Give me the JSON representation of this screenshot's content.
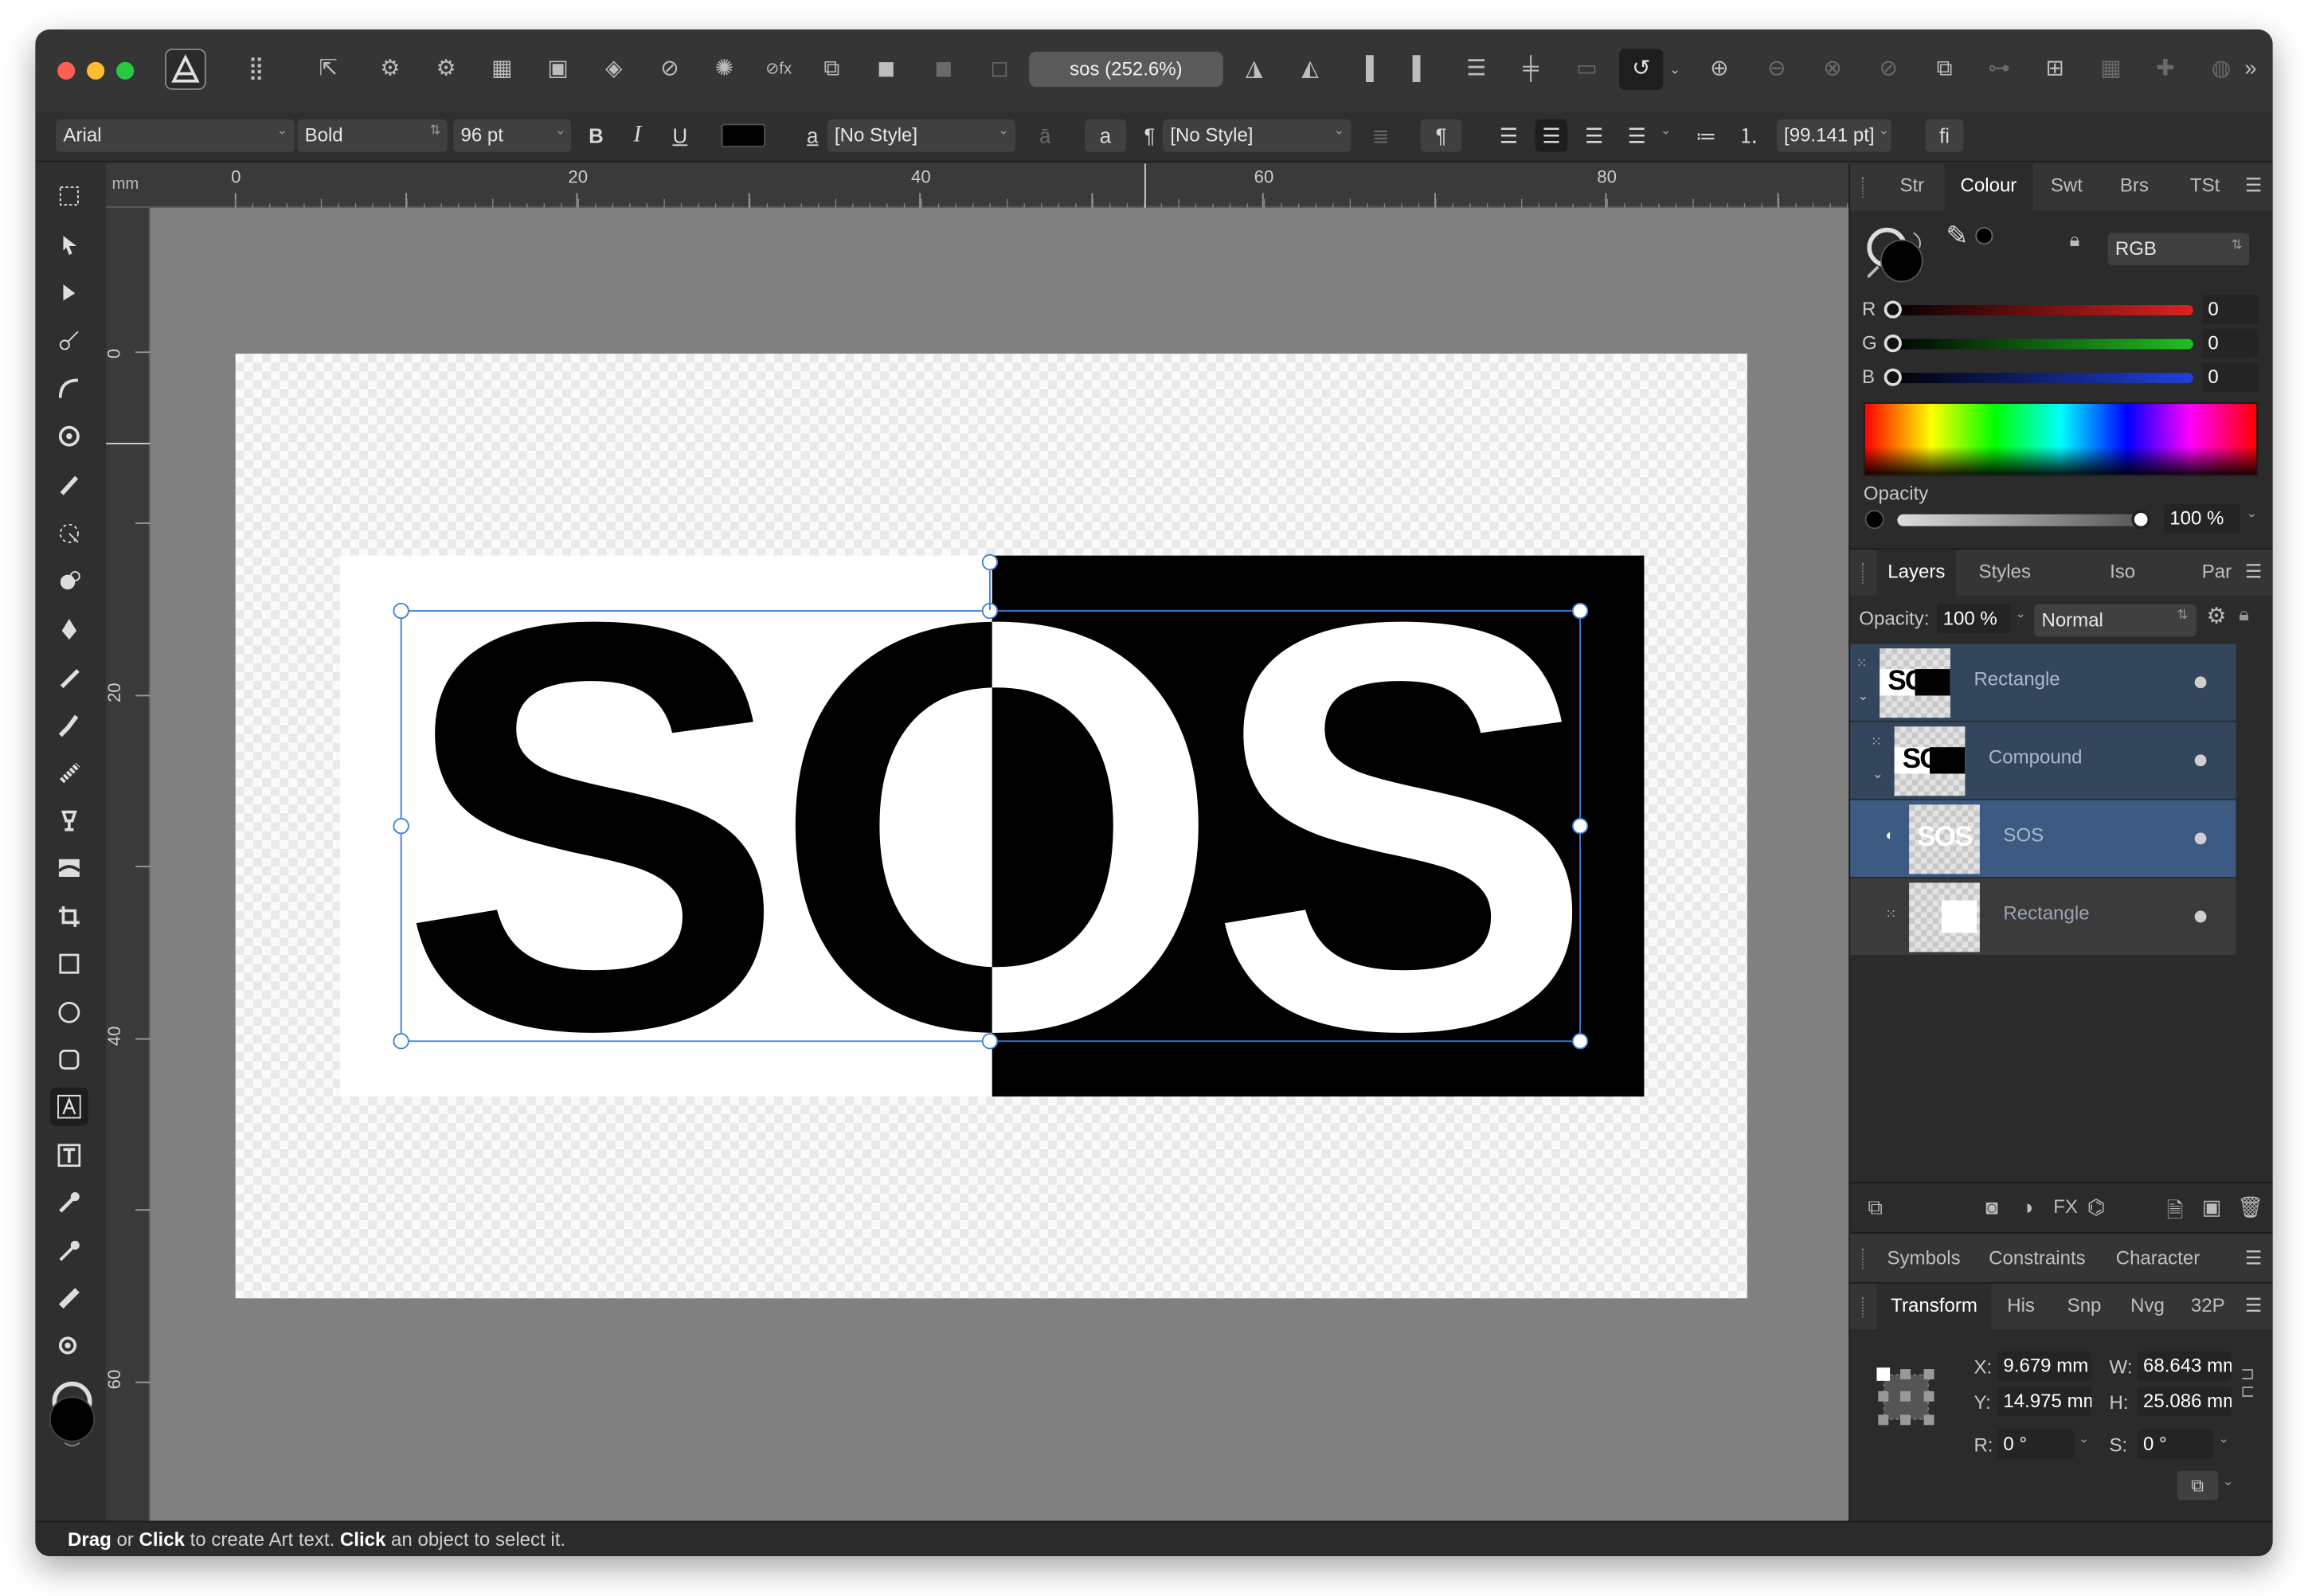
{
  "toolbar": {
    "doc_tab": "sos (252.6%)"
  },
  "context": {
    "font": "Arial",
    "weight": "Bold",
    "size": "96 pt",
    "bold": "B",
    "italic": "I",
    "underline": "U",
    "char_style_glyph": "a",
    "char_style": "[No Style]",
    "a_button": "a",
    "para_glyph": "¶",
    "para_style": "[No Style]",
    "para_button": "¶",
    "leading": "[99.141 pt]",
    "ligature": "fi",
    "text_color": "#000000"
  },
  "ruler": {
    "unit": "mm",
    "h_labels": [
      "0",
      "20",
      "40",
      "60",
      "80"
    ],
    "v_labels": [
      "0",
      "20",
      "40",
      "60"
    ]
  },
  "canvas": {
    "letters": "SOS"
  },
  "panels": {
    "top_tabs": [
      "Str",
      "Colour",
      "Swt",
      "Brs",
      "TSt"
    ],
    "active_top_tab": "Colour",
    "colour_model": "RGB",
    "channels": [
      {
        "label": "R",
        "value": "0",
        "color": "#e02020"
      },
      {
        "label": "G",
        "value": "0",
        "color": "#20c020"
      },
      {
        "label": "B",
        "value": "0",
        "color": "#2040e0"
      }
    ],
    "opacity_label": "Opacity",
    "opacity_value": "100 %",
    "layer_tabs": [
      "Layers",
      "Styles",
      "Iso",
      "Par"
    ],
    "layer_opacity_label": "Opacity:",
    "layer_opacity_value": "100 %",
    "blend_mode": "Normal",
    "layers": [
      {
        "name": "Rectangle",
        "thumb": "SOS"
      },
      {
        "name": "Compound",
        "thumb": "SOS"
      },
      {
        "name": "SOS",
        "thumb": "SOS"
      },
      {
        "name": "Rectangle",
        "thumb": ""
      }
    ],
    "extra_tabs": [
      "Symbols",
      "Constraints",
      "Character"
    ],
    "transform_tabs": [
      "Transform",
      "His",
      "Snp",
      "Nvg",
      "32P"
    ],
    "transform": {
      "x_label": "X:",
      "x": "9.679 mm",
      "y_label": "Y:",
      "y": "14.975 mm",
      "w_label": "W:",
      "w": "68.643 mm",
      "h_label": "H:",
      "h": "25.086 mm",
      "r_label": "R:",
      "r": "0 °",
      "s_label": "S:",
      "s": "0 °"
    }
  },
  "status": {
    "w1": "Drag",
    "t1": " or ",
    "w2": "Click",
    "t2": " to create Art text. ",
    "w3": "Click",
    "t3": " an object to select it."
  }
}
